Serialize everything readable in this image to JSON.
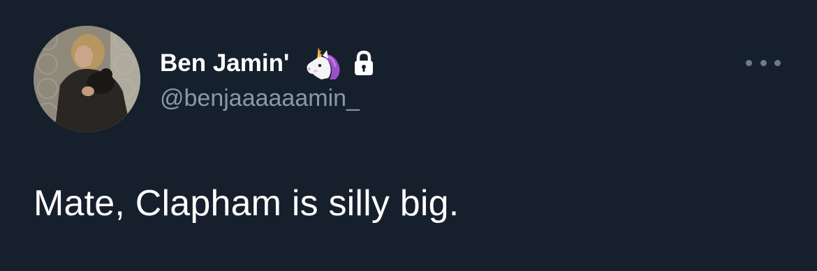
{
  "tweet": {
    "author": {
      "display_name": "Ben Jamin'",
      "handle": "@benjaaaaaamin_",
      "badges": [
        "unicorn-emoji-icon",
        "lock-icon"
      ],
      "protected": true
    },
    "text": "Mate, Clapham is silly big.",
    "more_menu_icon": "more-dots-icon"
  },
  "colors": {
    "background": "#16202c",
    "primary_text": "#ffffff",
    "secondary_text": "#8b98a5",
    "menu_dots": "#6e7b88"
  }
}
